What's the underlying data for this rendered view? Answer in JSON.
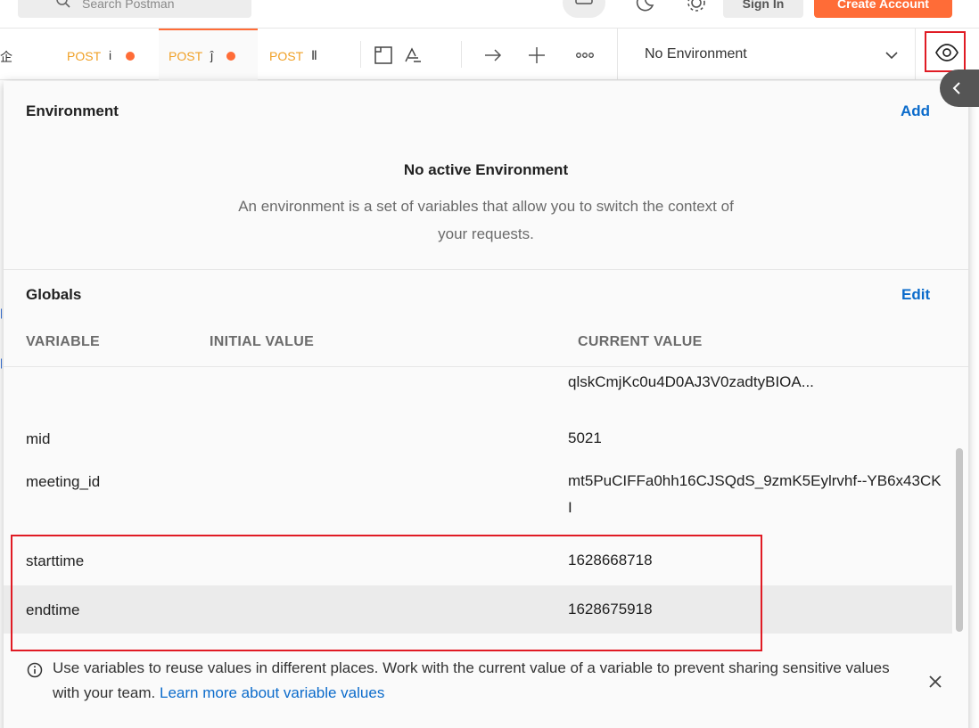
{
  "header": {
    "search_placeholder": "Search Postman",
    "signin_label": "Sign In",
    "create_label": "Create Account"
  },
  "tabs": [
    {
      "method": "POST",
      "glyph": "і",
      "unsaved": true
    },
    {
      "method": "POST",
      "glyph": "ĵ",
      "unsaved": true
    },
    {
      "method": "POST",
      "glyph": "Ⅱ",
      "unsaved": false
    }
  ],
  "environment_selector": {
    "selected": "No Environment"
  },
  "panel": {
    "environment": {
      "title": "Environment",
      "add_label": "Add",
      "empty_title": "No active Environment",
      "empty_desc": "An environment is a set of variables that allow you to switch the context of your requests."
    },
    "globals": {
      "title": "Globals",
      "edit_label": "Edit",
      "columns": {
        "variable": "VARIABLE",
        "initial": "INITIAL VALUE",
        "current": "CURRENT VALUE"
      },
      "rows": [
        {
          "name": "",
          "initial": "",
          "current": "qlskCmjKc0u4D0AJ3V0zadtyBIOA..."
        },
        {
          "name": "mid",
          "initial": "",
          "current": "5021"
        },
        {
          "name": "meeting_id",
          "initial": "",
          "current": "mt5PuCIFFa0hh16CJSQdS_9zmK5Eylrvhf--YB6x43CKI"
        },
        {
          "name": "starttime",
          "initial": "",
          "current": "1628668718"
        },
        {
          "name": "endtime",
          "initial": "",
          "current": "1628675918"
        }
      ]
    },
    "info": {
      "text": "Use variables to reuse values in different places. Work with the current value of a variable to prevent sharing sensitive values with your team.",
      "link": "Learn more about variable values"
    }
  },
  "colors": {
    "accent": "#ff6c37",
    "link": "#0b6bcb",
    "highlight": "#e01b24"
  }
}
